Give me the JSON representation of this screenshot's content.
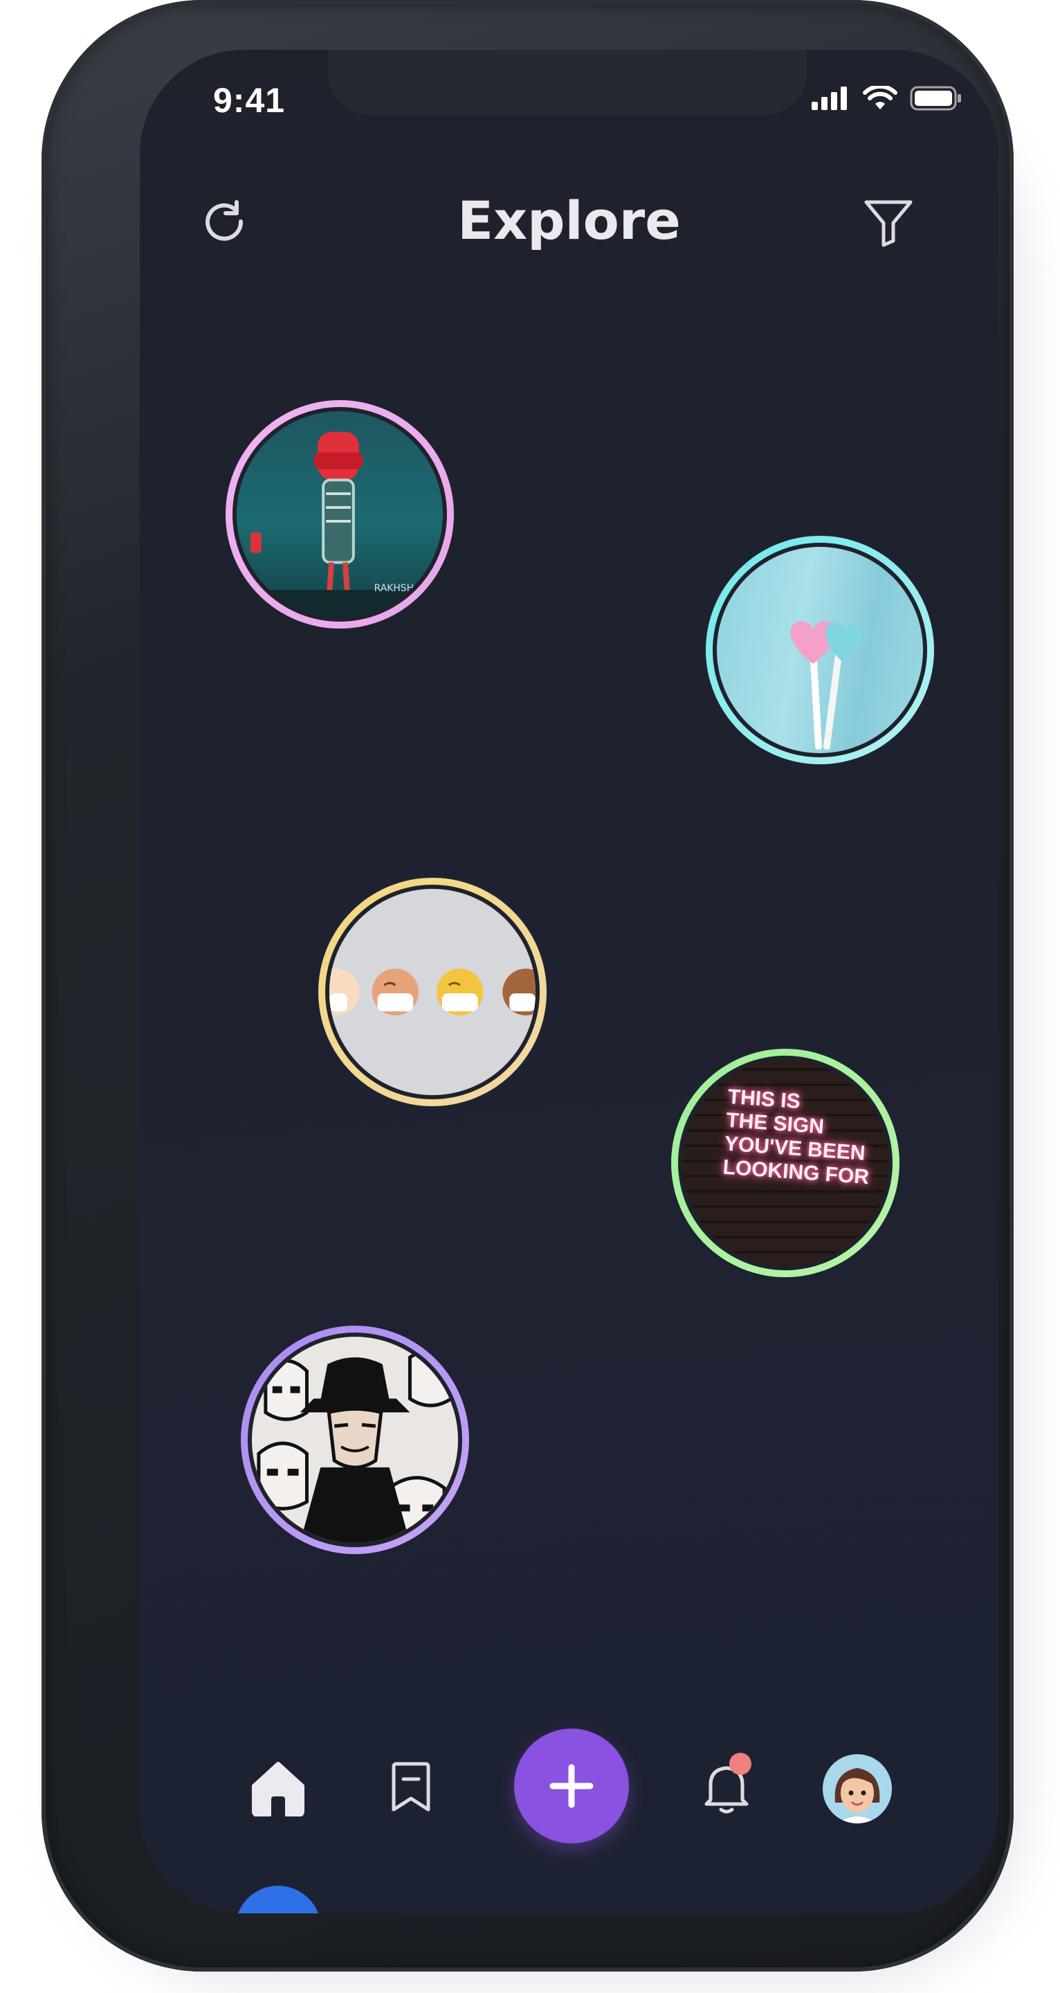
{
  "status_bar": {
    "time": "9:41"
  },
  "header": {
    "title": "Explore",
    "left_icon": "refresh-icon",
    "right_icon": "filter-icon"
  },
  "bubbles": [
    {
      "name": "skeleton-red-hood",
      "ring": [
        "#f0b3f3",
        "#e7a6ea"
      ]
    },
    {
      "name": "heart-lollipops",
      "ring": [
        "#6fe8ec",
        "#b6f1f2"
      ]
    },
    {
      "name": "masked-emojis",
      "ring": [
        "#f6d77e",
        "#efd9a8"
      ]
    },
    {
      "name": "neon-sign",
      "ring": [
        "#9ef09a",
        "#b8f2a9"
      ],
      "text": [
        "THIS IS",
        "THE SIGN",
        "YOU'VE BEEN",
        "LOOKING FOR"
      ]
    },
    {
      "name": "stormtroopers-comic",
      "ring": [
        "#a98af0",
        "#c6a4f6"
      ]
    }
  ],
  "bottom_nav": {
    "items": [
      "home-icon",
      "bookmark-icon",
      "add-icon",
      "notification-bell-icon",
      "profile-avatar"
    ],
    "accent": "#8a52e0",
    "indicator_color": "#2f6fe8",
    "notification_dot_color": "#f0807a"
  }
}
